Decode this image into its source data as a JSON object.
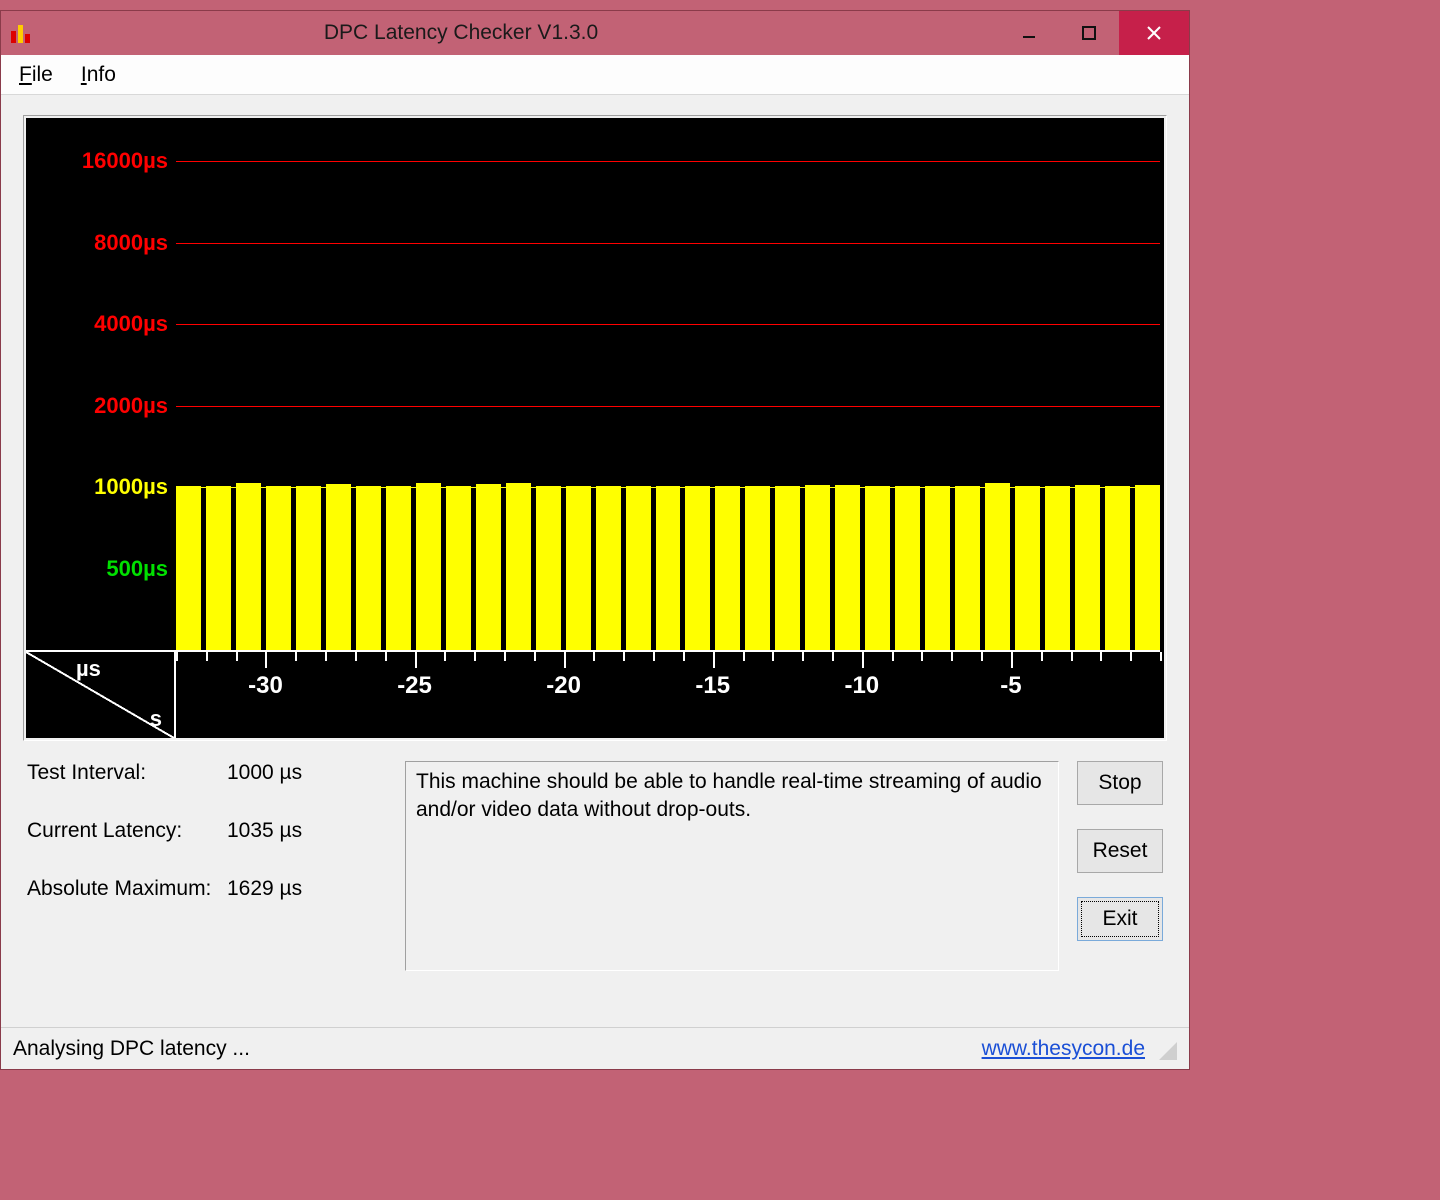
{
  "window": {
    "title": "DPC Latency Checker V1.3.0"
  },
  "menubar": {
    "file": "File",
    "info": "Info"
  },
  "chart_data": {
    "type": "bar",
    "y_unit_label": "µs",
    "x_unit_label": "s",
    "y_ticks": [
      {
        "value": 500,
        "label": "500µs",
        "color": "#00e000",
        "line": false
      },
      {
        "value": 1000,
        "label": "1000µs",
        "color": "#ffff00",
        "line": true,
        "line_color": "#ffff00"
      },
      {
        "value": 2000,
        "label": "2000µs",
        "color": "#ff0000",
        "line": true,
        "line_color": "#ff0000"
      },
      {
        "value": 4000,
        "label": "4000µs",
        "color": "#ff0000",
        "line": true,
        "line_color": "#ff0000"
      },
      {
        "value": 8000,
        "label": "8000µs",
        "color": "#ff0000",
        "line": true,
        "line_color": "#ff0000"
      },
      {
        "value": 16000,
        "label": "16000µs",
        "color": "#ff0000",
        "line": true,
        "line_color": "#ff0000"
      }
    ],
    "x_major_ticks": [
      -30,
      -25,
      -20,
      -15,
      -10,
      -5
    ],
    "x_range": [
      -33,
      0
    ],
    "values": [
      1010,
      1010,
      1035,
      1010,
      1010,
      1025,
      1010,
      1010,
      1035,
      1010,
      1025,
      1035,
      1010,
      1010,
      1010,
      1010,
      1010,
      1010,
      1010,
      1010,
      1010,
      1020,
      1020,
      1010,
      1010,
      1010,
      1010,
      1035,
      1010,
      1010,
      1015,
      1010,
      1020
    ],
    "y_transform": "log"
  },
  "metrics": {
    "test_interval_label": "Test Interval:",
    "test_interval_value": "1000 µs",
    "current_latency_label": "Current Latency:",
    "current_latency_value": "1035 µs",
    "absolute_maximum_label": "Absolute Maximum:",
    "absolute_maximum_value": "1629 µs"
  },
  "message": "This machine should be able to handle real-time streaming of audio and/or video data without drop-outs.",
  "buttons": {
    "stop": "Stop",
    "reset": "Reset",
    "exit": "Exit"
  },
  "statusbar": {
    "text": "Analysing DPC latency ...",
    "link": "www.thesycon.de"
  }
}
